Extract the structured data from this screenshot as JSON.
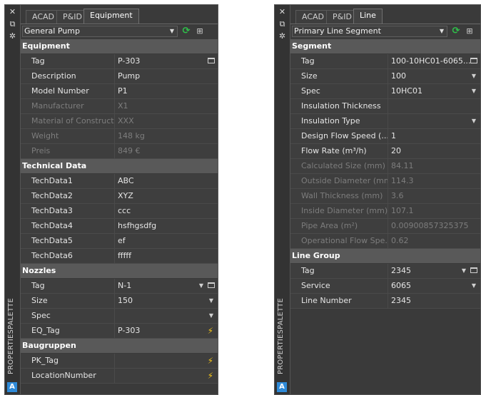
{
  "rail": {
    "close_glyph": "✕",
    "pin_glyph": "⧉",
    "settings_glyph": "✲",
    "title": "PROPERTIESPALETTE",
    "logo": "A"
  },
  "left": {
    "tabs": [
      "ACAD",
      "P&ID",
      "Equipment"
    ],
    "selector": "General Pump",
    "sections": [
      {
        "title": "Equipment",
        "rows": [
          {
            "label": "Tag",
            "value": "P-303",
            "control": "box"
          },
          {
            "label": "Description",
            "value": "Pump"
          },
          {
            "label": "Model Number",
            "value": "P1"
          },
          {
            "label": "Manufacturer",
            "value": "X1",
            "disabled": true
          },
          {
            "label": "Material of Construction",
            "value": "XXX",
            "disabled": true
          },
          {
            "label": "Weight",
            "value": "148 kg",
            "disabled": true
          },
          {
            "label": "Preis",
            "value": "849 €",
            "disabled": true
          }
        ]
      },
      {
        "title": "Technical Data",
        "rows": [
          {
            "label": "TechData1",
            "value": "ABC"
          },
          {
            "label": "TechData2",
            "value": "XYZ"
          },
          {
            "label": "TechData3",
            "value": "ccc"
          },
          {
            "label": "TechData4",
            "value": "hsfhgsdfg"
          },
          {
            "label": "TechData5",
            "value": "ef"
          },
          {
            "label": "TechData6",
            "value": "fffff"
          }
        ]
      },
      {
        "title": "Nozzles",
        "rows": [
          {
            "label": "Tag",
            "value": "N-1",
            "control": "dd-box"
          },
          {
            "label": "Size",
            "value": "150",
            "control": "dd"
          },
          {
            "label": "Spec",
            "value": "",
            "control": "dd"
          },
          {
            "label": "EQ_Tag",
            "value": "P-303",
            "control": "bolt"
          }
        ]
      },
      {
        "title": "Baugruppen",
        "rows": [
          {
            "label": "PK_Tag",
            "value": "",
            "control": "bolt"
          },
          {
            "label": "LocationNumber",
            "value": "",
            "control": "bolt"
          }
        ]
      }
    ]
  },
  "right": {
    "tabs": [
      "ACAD",
      "P&ID",
      "Line"
    ],
    "selector": "Primary Line Segment",
    "sections": [
      {
        "title": "Segment",
        "rows": [
          {
            "label": "Tag",
            "value": "100-10HC01-6065...",
            "control": "box"
          },
          {
            "label": "Size",
            "value": "100",
            "control": "dd"
          },
          {
            "label": "Spec",
            "value": "10HC01",
            "control": "dd"
          },
          {
            "label": "Insulation Thickness",
            "value": ""
          },
          {
            "label": "Insulation Type",
            "value": "",
            "control": "dd"
          },
          {
            "label": "Design Flow Speed (...",
            "value": "1"
          },
          {
            "label": "Flow Rate (m³/h)",
            "value": "20"
          },
          {
            "label": "Calculated Size (mm)",
            "value": "84.11",
            "disabled": true
          },
          {
            "label": "Outside Diameter (mm)",
            "value": "114.3",
            "disabled": true
          },
          {
            "label": "Wall Thickness (mm)",
            "value": "3.6",
            "disabled": true
          },
          {
            "label": "Inside Diameter (mm)",
            "value": "107.1",
            "disabled": true
          },
          {
            "label": "Pipe Area (m²)",
            "value": "0.00900857325375",
            "disabled": true
          },
          {
            "label": "Operational Flow Spe...",
            "value": "0.62",
            "disabled": true
          }
        ]
      },
      {
        "title": "Line Group",
        "rows": [
          {
            "label": "Tag",
            "value": "2345",
            "control": "dd-box"
          },
          {
            "label": "Service",
            "value": "6065",
            "control": "dd"
          },
          {
            "label": "Line Number",
            "value": "2345"
          }
        ]
      }
    ]
  },
  "colors": {
    "panel": "#3a3a3a",
    "section": "#595959",
    "refresh": "#2fbf4a",
    "bolt": "#f5c518",
    "logo": "#2e8ad8"
  }
}
